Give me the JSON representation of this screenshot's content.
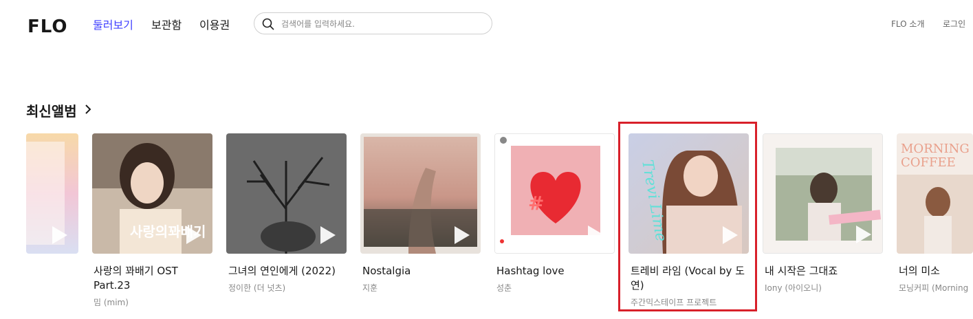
{
  "header": {
    "logo": "FLO",
    "nav": [
      "둘러보기",
      "보관함",
      "이용권"
    ],
    "search_placeholder": "검색어를 입력하세요.",
    "links": [
      "FLO 소개",
      "로그인"
    ]
  },
  "section": {
    "title": "최신앨범"
  },
  "albums": [
    {
      "title": "사랑의 꽈배기 OST Part.23",
      "artist": "밈 (mim)"
    },
    {
      "title": "그녀의 연인에게 (2022)",
      "artist": "정이한 (더 넛츠)"
    },
    {
      "title": "Nostalgia",
      "artist": "지훈"
    },
    {
      "title": "Hashtag love",
      "artist": "성춘"
    },
    {
      "title": "트레비 라임 (Vocal by 도연)",
      "artist": "주간믹스테이프 프로젝트"
    },
    {
      "title": "내 시작은 그대죠",
      "artist": "Iony (아이오니)"
    },
    {
      "title": "너의 미소",
      "artist": "모닝커피 (Morning"
    }
  ],
  "colors": {
    "accent": "#3f3fff",
    "highlight_box": "#d8202a"
  }
}
